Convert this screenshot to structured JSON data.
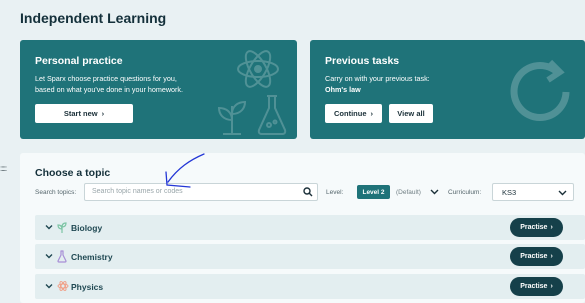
{
  "page": {
    "title": "Independent Learning"
  },
  "personal": {
    "title": "Personal practice",
    "text_line1": "Let Sparx choose practice questions for you,",
    "text_line2": "based on what you've done in your homework.",
    "button": "Start new",
    "button_icon": "chevron-right-icon",
    "deco_icons": [
      "atom-icon",
      "plant-icon",
      "flask-icon"
    ]
  },
  "previous": {
    "title": "Previous tasks",
    "text_line1": "Carry on with your previous task:",
    "task_name": "Ohm's law",
    "continue_button": "Continue",
    "viewall_button": "View all",
    "deco_icons": [
      "refresh-icon"
    ]
  },
  "left_edge_marker": ":::::",
  "topic": {
    "title": "Choose a topic",
    "search_label": "Search topics:",
    "search_placeholder": "Search topic names or codes",
    "level_label": "Level:",
    "level_value": "Level 2",
    "level_default": "(Default)",
    "curriculum_label": "Curriculum:",
    "curriculum_value": "KS3"
  },
  "subjects": [
    {
      "name": "Biology",
      "button": "Practise",
      "icon": "plant-icon",
      "icon_color": "#7cc4a4"
    },
    {
      "name": "Chemistry",
      "button": "Practise",
      "icon": "flask-icon",
      "icon_color": "#a78fd6"
    },
    {
      "name": "Physics",
      "button": "Practise",
      "icon": "atom-icon",
      "icon_color": "#f0a088"
    }
  ],
  "colors": {
    "teal": "#1f7379",
    "dark": "#15404a",
    "background": "#e9f1f3",
    "annotation": "#2336d6"
  }
}
